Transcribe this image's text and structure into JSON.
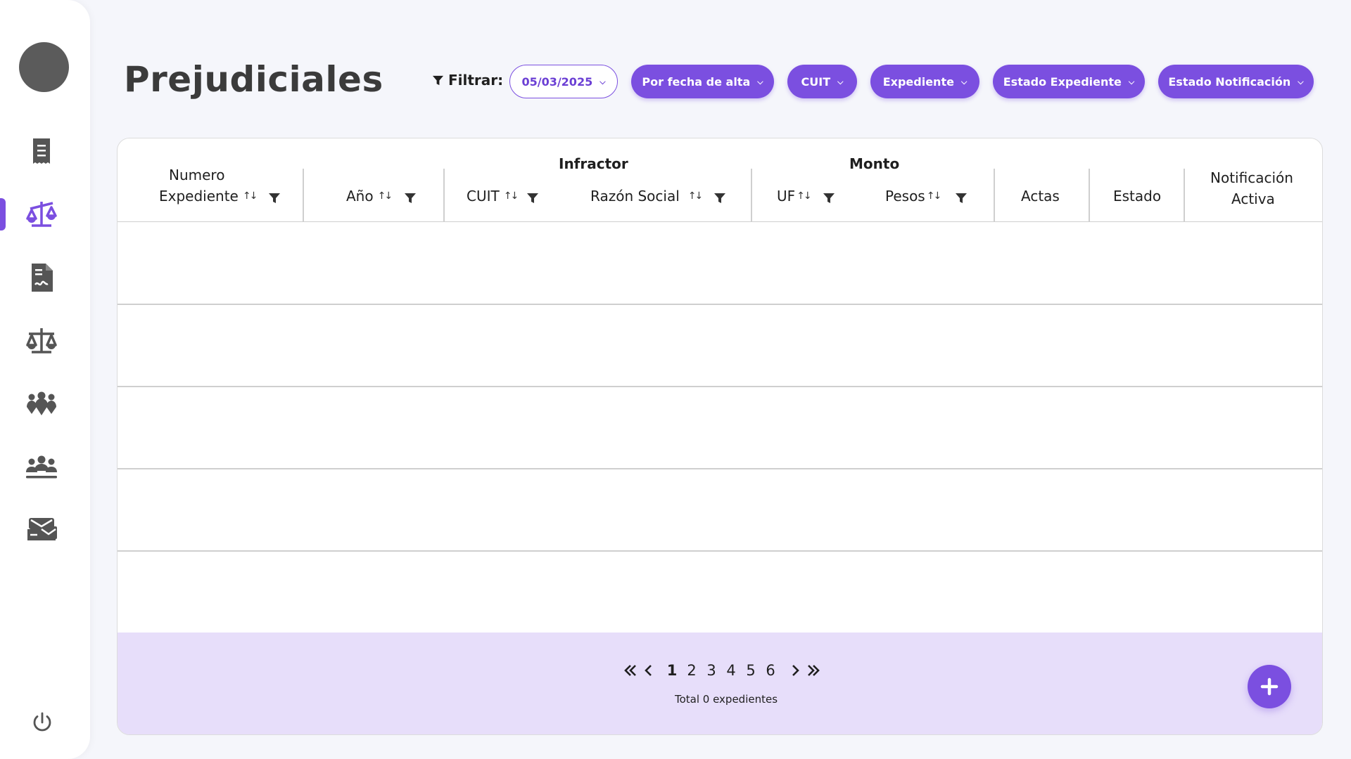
{
  "sidebar": {
    "items": [
      {
        "icon": "document-list-icon"
      },
      {
        "icon": "scales-icon",
        "active": true
      },
      {
        "icon": "file-signature-icon"
      },
      {
        "icon": "scales-icon"
      },
      {
        "icon": "group-icon"
      },
      {
        "icon": "users-icon"
      },
      {
        "icon": "mail-inbox-icon"
      }
    ],
    "accent": "#7b4fe0",
    "power_icon": "power-icon"
  },
  "header": {
    "title": "Prejudiciales",
    "filter_label": "Filtrar:",
    "filters": [
      {
        "label": "05/03/2025",
        "style": "outline"
      },
      {
        "label": "Por fecha de alta",
        "style": "solid"
      },
      {
        "label": "CUIT",
        "style": "solid"
      },
      {
        "label": "Expediente",
        "style": "solid"
      },
      {
        "label": "Estado Expediente",
        "style": "solid"
      },
      {
        "label": "Estado Notificación",
        "style": "solid"
      }
    ]
  },
  "table": {
    "groups": {
      "infractor": "Infractor",
      "monto": "Monto"
    },
    "columns": {
      "numero_line1": "Numero",
      "numero_line2": "Expediente",
      "anio": "Año",
      "cuit": "CUIT",
      "razon_social": "Razón Social",
      "uf": "UF",
      "pesos": "Pesos",
      "actas": "Actas",
      "estado": "Estado",
      "notif_line1": "Notificación",
      "notif_line2": "Activa"
    },
    "sort_glyph": "↑↓",
    "rows": []
  },
  "footer": {
    "pages": [
      "1",
      "2",
      "3",
      "4",
      "5",
      "6"
    ],
    "current_page": "1",
    "total_text": "Total 0 expedientes",
    "add_icon": "plus-icon"
  }
}
